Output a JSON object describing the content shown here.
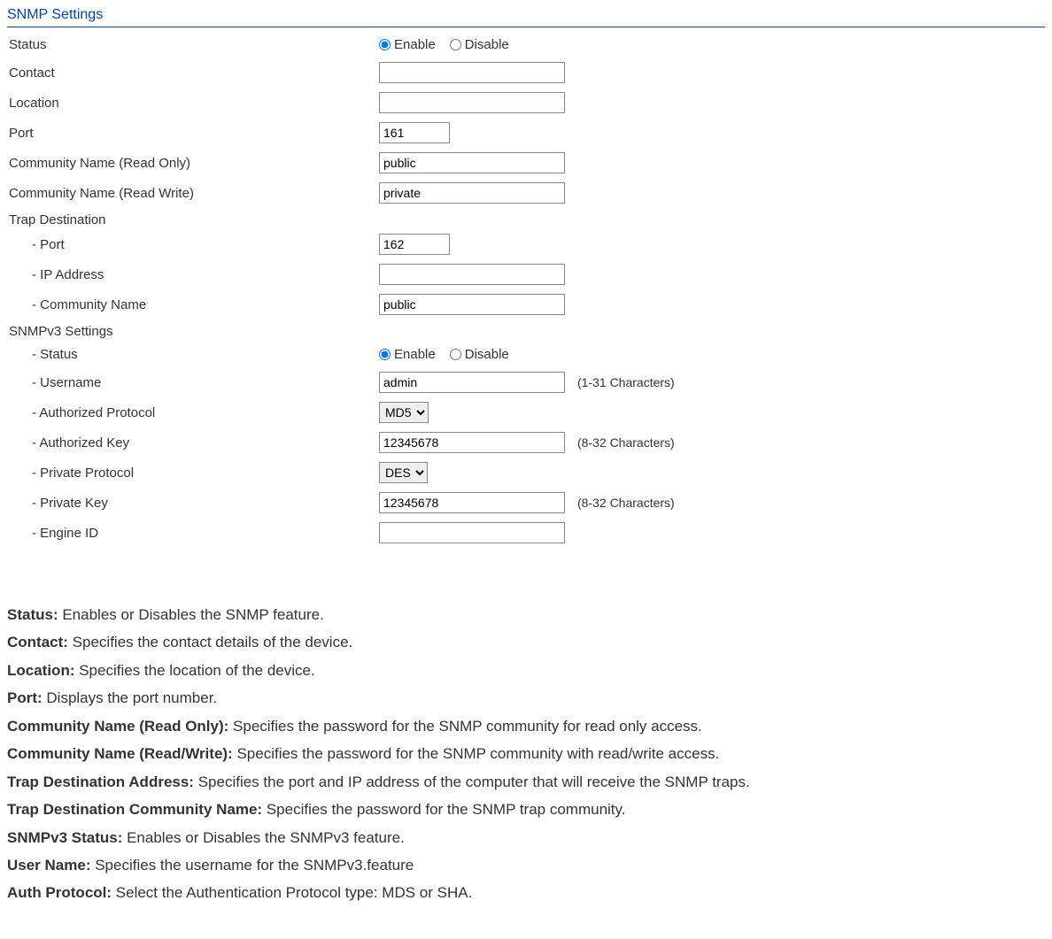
{
  "title": "SNMP Settings",
  "radio": {
    "enable": "Enable",
    "disable": "Disable"
  },
  "fields": {
    "status": "Status",
    "contact": "Contact",
    "location": "Location",
    "port": "Port",
    "port_value": "161",
    "comm_ro": "Community Name (Read Only)",
    "comm_ro_value": "public",
    "comm_rw": "Community Name (Read Write)",
    "comm_rw_value": "private",
    "trap_dest": "Trap Destination",
    "trap_port": "- Port",
    "trap_port_value": "162",
    "trap_ip": "- IP Address",
    "trap_comm": "- Community Name",
    "trap_comm_value": "public",
    "v3_settings": "SNMPv3 Settings",
    "v3_status": "- Status",
    "v3_user": "- Username",
    "v3_user_value": "admin",
    "v3_user_hint": "(1-31 Characters)",
    "v3_auth_proto": "- Authorized Protocol",
    "v3_auth_proto_value": "MD5",
    "v3_auth_key": "- Authorized Key",
    "v3_auth_key_value": "12345678",
    "v3_auth_key_hint": "(8-32 Characters)",
    "v3_priv_proto": "- Private Protocol",
    "v3_priv_proto_value": "DES",
    "v3_priv_key": "- Private Key",
    "v3_priv_key_value": "12345678",
    "v3_priv_key_hint": "(8-32 Characters)",
    "v3_engine": "- Engine ID"
  },
  "desc": {
    "status_b": "Status:",
    "status_t": " Enables or Disables the SNMP feature.",
    "contact_b": "Contact:",
    "contact_t": " Specifies the contact details of the device.",
    "location_b": "Location:",
    "location_t": " Specifies the location of the device.",
    "port_b": "Port:",
    "port_t": " Displays the port number.",
    "comm_ro_b": "Community Name (Read Only):",
    "comm_ro_t": " Specifies the password for the SNMP community for read only access.",
    "comm_rw_b": "Community Name (Read/Write):",
    "comm_rw_t": " Specifies the password for the SNMP community with read/write access.",
    "trap_addr_b": "Trap Destination Address:",
    "trap_addr_t": " Specifies the port and IP address of the computer that will receive the SNMP traps.",
    "trap_comm_b": "Trap Destination Community Name:",
    "trap_comm_t": " Specifies the password for the SNMP trap community.",
    "v3_status_b": "SNMPv3 Status:",
    "v3_status_t": " Enables or Disables the SNMPv3 feature.",
    "v3_user_b": "User Name:",
    "v3_user_t": " Specifies the username for the SNMPv3.feature",
    "v3_auth_b": "Auth Protocol:",
    "v3_auth_t": " Select the Authentication Protocol type: MDS or SHA."
  }
}
